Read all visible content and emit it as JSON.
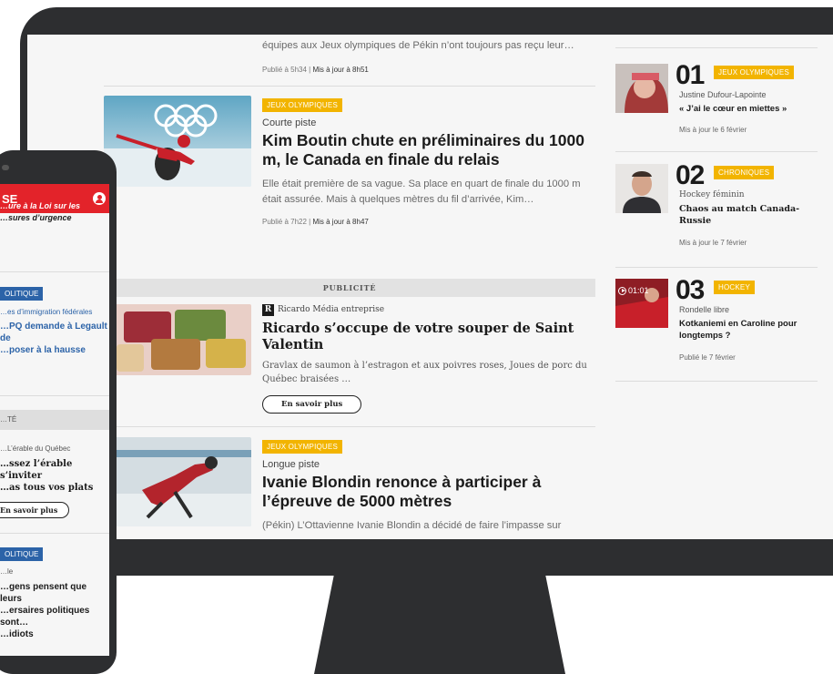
{
  "articles": [
    {
      "lede": "équipes aux Jeux olympiques de Pékin n’ont toujours pas reçu leur…",
      "published": "Publié à 5h34",
      "updated": "Mis à jour à 8h51"
    },
    {
      "badge": "JEUX OLYMPIQUES",
      "rubric": "Courte piste",
      "title": "Kim Boutin chute en préliminaires du 1000 m, le Canada en finale du relais",
      "lede": "Elle était première de sa vague. Sa place en quart de finale du 1000 m était assurée. Mais à quelques mètres du fil d’arrivée, Kim…",
      "published": "Publié à 7h22",
      "updated": "Mis à jour à 8h47"
    },
    {
      "badge": "JEUX OLYMPIQUES",
      "rubric": "Longue piste",
      "title": "Ivanie Blondin renonce à participer à l’épreuve de 5000 mètres",
      "lede": "(Pékin) L’Ottavienne Ivanie Blondin a décidé de faire l’impasse sur"
    }
  ],
  "ad": {
    "label": "PUBLICITÉ",
    "logo_letter": "R",
    "brand": "Ricardo Média entreprise",
    "title": "Ricardo s’occupe de votre souper de Saint Valentin",
    "text": "Gravlax de saumon à l’estragon et aux poivres roses, Joues de porc du Québec braisées …",
    "button": "En savoir plus"
  },
  "ranking": [
    {
      "number": "01",
      "badge": "JEUX OLYMPIQUES",
      "sub": "Justine Dufour-Lapointe",
      "title": "« J’ai le cœur en miettes »",
      "meta": "Mis à jour le 6 février"
    },
    {
      "number": "02",
      "badge": "CHRONIQUES",
      "sub": "Hockey féminin",
      "title": "Chaos au match Canada-Russie",
      "meta": "Mis à jour le 7 février"
    },
    {
      "number": "03",
      "badge": "HOCKEY",
      "video_time": "01:01",
      "sub": "Rondelle libre",
      "title": "Kotkaniemi en Caroline pour longtemps ?",
      "meta": "Publié le 7 février"
    }
  ],
  "phone": {
    "brand_fragment": "SE",
    "top_lines": [
      "…ure à la Loi sur les",
      "…sures d’urgence"
    ],
    "item1": {
      "badge": "OLITIQUE",
      "rubric": "…es d’immigration fédérales",
      "title_lines": [
        "…PQ demande à Legault de",
        "…poser à la hausse"
      ]
    },
    "pub_label": "…TÉ",
    "ad": {
      "brand": "…L’érable du Québec",
      "title_lines": [
        "…ssez l’érable s’inviter",
        "…as tous vos plats"
      ],
      "button": "En savoir plus"
    },
    "item2": {
      "badge": "OLITIQUE",
      "rubric": "…le",
      "title_lines": [
        "…gens pensent que leurs",
        "…ersaires politiques sont…",
        "…idiots"
      ]
    }
  },
  "colors": {
    "badge_yellow": "#f2b400",
    "brand_red": "#e3232a",
    "politique_blue": "#2c63a8",
    "device_dark": "#2d2e30"
  }
}
